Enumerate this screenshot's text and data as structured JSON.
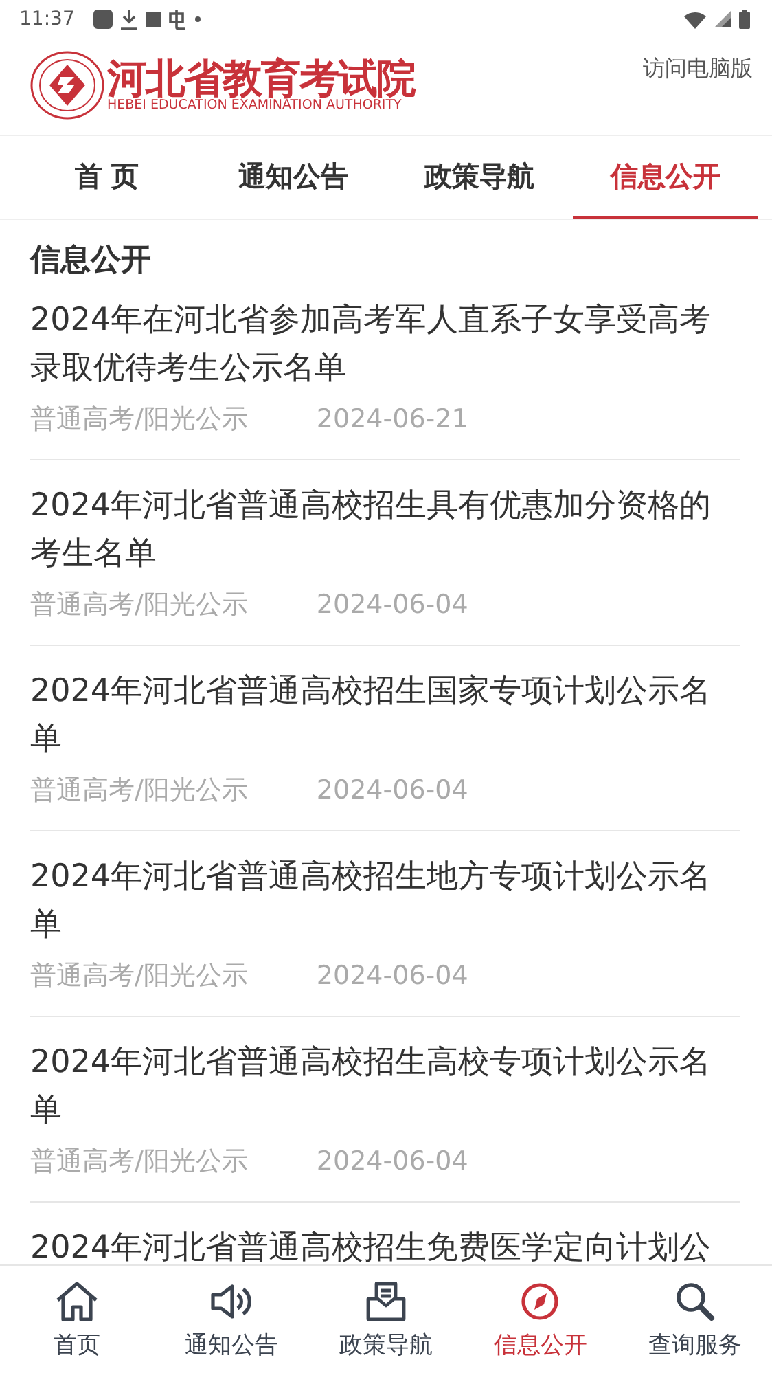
{
  "status_bar": {
    "time": "11:37"
  },
  "header": {
    "logo_title": "河北省教育考试院",
    "logo_subtitle": "HEBEI EDUCATION EXAMINATION AUTHORITY",
    "desktop_link": "访问电脑版"
  },
  "tabs": [
    {
      "label": "首 页",
      "selected": false
    },
    {
      "label": "通知公告",
      "selected": false
    },
    {
      "label": "政策导航",
      "selected": false
    },
    {
      "label": "信息公开",
      "selected": true
    }
  ],
  "section_title": "信息公开",
  "articles": [
    {
      "title": "2024年在河北省参加高考军人直系子女享受高考录取优待考生公示名单",
      "category": "普通高考/阳光公示",
      "date": "2024-06-21"
    },
    {
      "title": "2024年河北省普通高校招生具有优惠加分资格的考生名单",
      "category": "普通高考/阳光公示",
      "date": "2024-06-04"
    },
    {
      "title": "2024年河北省普通高校招生国家专项计划公示名单",
      "category": "普通高考/阳光公示",
      "date": "2024-06-04"
    },
    {
      "title": "2024年河北省普通高校招生地方专项计划公示名单",
      "category": "普通高考/阳光公示",
      "date": "2024-06-04"
    },
    {
      "title": "2024年河北省普通高校招生高校专项计划公示名单",
      "category": "普通高考/阳光公示",
      "date": "2024-06-04"
    },
    {
      "title": "2024年河北省普通高校招生免费医学定向计划公"
    }
  ],
  "bottom_nav": [
    {
      "kind": "home",
      "label": "首页",
      "selected": false
    },
    {
      "kind": "speaker",
      "label": "通知公告",
      "selected": false
    },
    {
      "kind": "inbox",
      "label": "政策导航",
      "selected": false
    },
    {
      "kind": "compass",
      "label": "信息公开",
      "selected": true
    },
    {
      "kind": "search",
      "label": "查询服务",
      "selected": false
    }
  ]
}
